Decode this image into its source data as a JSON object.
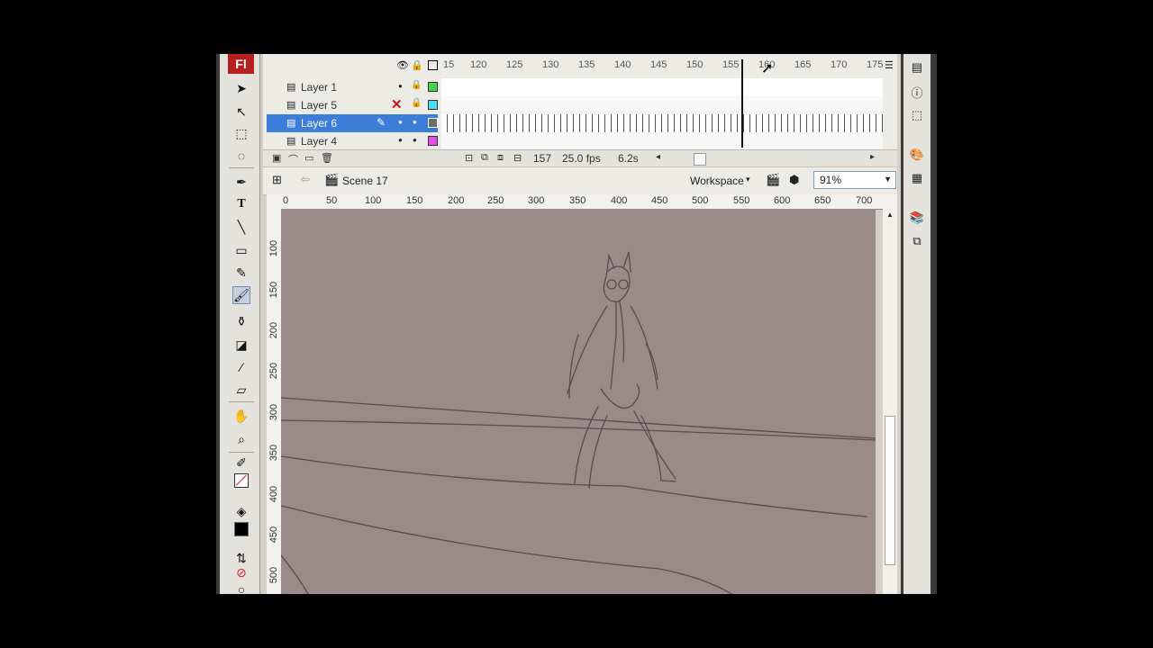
{
  "app": {
    "logo": "Fl"
  },
  "timeline": {
    "ruler": [
      "15",
      "120",
      "125",
      "130",
      "135",
      "140",
      "145",
      "150",
      "155",
      "160",
      "165",
      "170",
      "175"
    ],
    "layers": [
      {
        "name": "Layer 1",
        "color": "#44d44a",
        "selected": false
      },
      {
        "name": "Layer 5",
        "color": "#4ddcee",
        "selected": false
      },
      {
        "name": "Layer 6",
        "color": "#6d6d6d",
        "selected": true
      },
      {
        "name": "Layer 4",
        "color": "#e84ce8",
        "selected": false
      }
    ],
    "footer": {
      "frame": "157",
      "fps": "25.0 fps",
      "time": "6.2s"
    }
  },
  "editbar": {
    "scene": "Scene 17",
    "workspace": "Workspace",
    "zoom": "91%"
  },
  "hruler": [
    "0",
    "50",
    "100",
    "150",
    "200",
    "250",
    "300",
    "350",
    "400",
    "450",
    "500",
    "550",
    "600",
    "650",
    "700"
  ],
  "vruler": [
    "100",
    "150",
    "200",
    "250",
    "300",
    "350",
    "400",
    "450",
    "500"
  ],
  "colors": {
    "stage": "#9b8a8a",
    "selection": "#3b7dd8",
    "logo": "#b8201e"
  }
}
